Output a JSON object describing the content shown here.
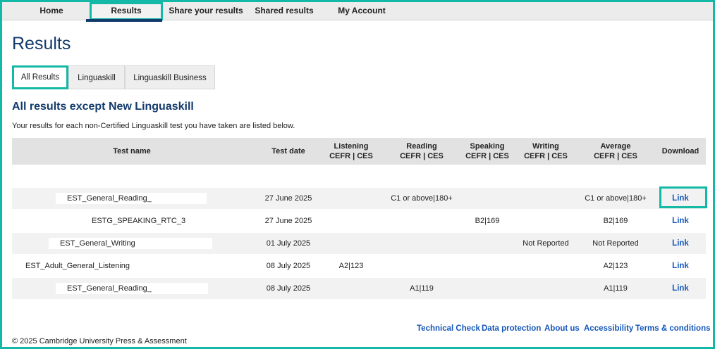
{
  "nav": {
    "home": "Home",
    "results": "Results",
    "share": "Share your results",
    "shared": "Shared results",
    "account": "My Account"
  },
  "page": {
    "title": "Results",
    "tabs": [
      "All Results",
      "Linguaskill",
      "Linguaskill Business"
    ],
    "section_title": "All results except New Linguaskill",
    "section_desc": "Your results for each non-Certified Linguaskill test you have taken are listed below."
  },
  "table": {
    "headers": {
      "name": "Test name",
      "date": "Test date",
      "listening": [
        "Listening",
        "CEFR | CES"
      ],
      "reading": [
        "Reading",
        "CEFR | CES"
      ],
      "speaking": [
        "Speaking",
        "CEFR | CES"
      ],
      "writing": [
        "Writing",
        "CEFR | CES"
      ],
      "average": [
        "Average",
        "CEFR | CES"
      ],
      "download": "Download"
    },
    "rows": [
      {
        "name": "EST_General_Reading_",
        "date": "27 June 2025",
        "listening": "",
        "reading": "C1 or above|180+",
        "speaking": "",
        "writing": "",
        "average": "C1 or above|180+",
        "download": "Link"
      },
      {
        "name": "ESTG_SPEAKING_RTC_3",
        "date": "27 June 2025",
        "listening": "",
        "reading": "",
        "speaking": "B2|169",
        "writing": "",
        "average": "B2|169",
        "download": "Link"
      },
      {
        "name": "EST_General_Writing",
        "date": "01 July 2025",
        "listening": "",
        "reading": "",
        "speaking": "",
        "writing": "Not Reported",
        "average": "Not Reported",
        "download": "Link"
      },
      {
        "name": "EST_Adult_General_Listening",
        "date": "08 July 2025",
        "listening": "A2|123",
        "reading": "",
        "speaking": "",
        "writing": "",
        "average": "A2|123",
        "download": "Link"
      },
      {
        "name": "EST_General_Reading_",
        "date": "08 July 2025",
        "listening": "",
        "reading": "A1|119",
        "speaking": "",
        "writing": "",
        "average": "A1|119",
        "download": "Link"
      }
    ]
  },
  "footer": {
    "links": [
      "Technical Check",
      "Data protection",
      "About us",
      "Accessibility",
      "Terms & conditions"
    ],
    "copyright": "© 2025 Cambridge University Press & Assessment"
  },
  "colors": {
    "highlight": "#14b8a6",
    "brand_navy": "#123a6b",
    "link_blue": "#1456b8"
  }
}
